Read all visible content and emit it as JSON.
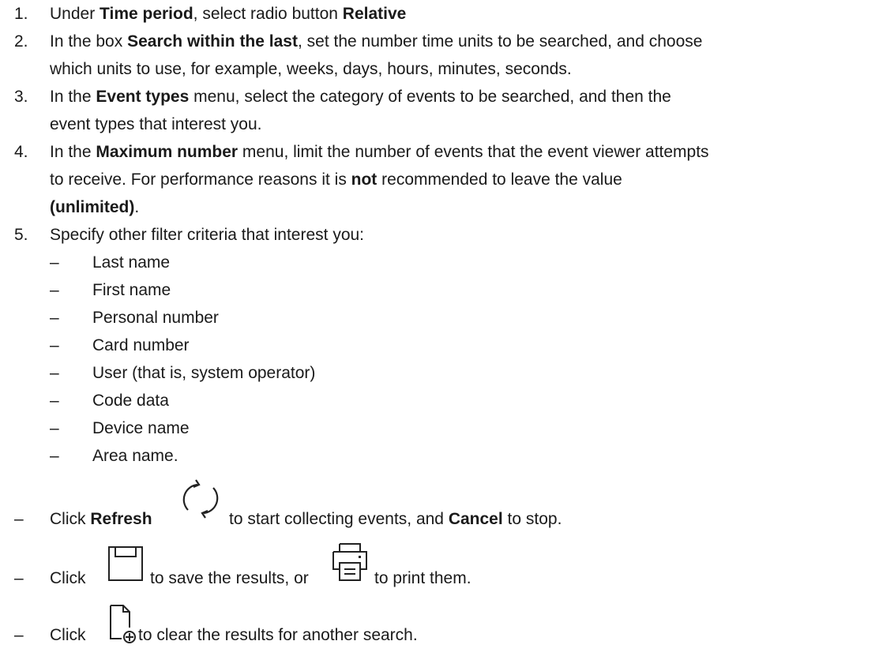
{
  "steps": [
    {
      "num": "1.",
      "parts": [
        {
          "t": "Under "
        },
        {
          "t": "Time period",
          "b": true
        },
        {
          "t": ", select radio button "
        },
        {
          "t": "Relative",
          "b": true
        }
      ]
    },
    {
      "num": "2.",
      "parts": [
        {
          "t": "In the box "
        },
        {
          "t": "Search within the last",
          "b": true
        },
        {
          "t": ", set the number time units to be searched, and choose"
        }
      ],
      "line2": "which units to use, for example, weeks, days, hours, minutes, seconds."
    },
    {
      "num": "3.",
      "parts": [
        {
          "t": "In the "
        },
        {
          "t": "Event types",
          "b": true
        },
        {
          "t": " menu, select the category of events to be searched, and then the"
        }
      ],
      "line2": "event types that interest you."
    },
    {
      "num": "4.",
      "parts": [
        {
          "t": "In the "
        },
        {
          "t": "Maximum number",
          "b": true
        },
        {
          "t": " menu, limit the number of events that the event viewer attempts"
        }
      ],
      "line2_parts": [
        {
          "t": "to receive. For performance reasons it is "
        },
        {
          "t": "not",
          "b": true
        },
        {
          "t": " recommended to leave the value"
        }
      ],
      "line3_parts": [
        {
          "t": "(unlimited)",
          "b": true
        },
        {
          "t": "."
        }
      ]
    },
    {
      "num": "5.",
      "parts": [
        {
          "t": "Specify other filter criteria that interest you:"
        }
      ]
    }
  ],
  "dash": "–",
  "criteria": [
    "Last name",
    "First name",
    "Personal number",
    "Card number",
    "User (that is, system operator)",
    "Code data",
    "Device name",
    "Area name."
  ],
  "bullets": {
    "refresh": {
      "pre": "Click ",
      "bold1": "Refresh",
      "mid": " to start collecting events, and ",
      "bold2": "Cancel",
      "post": " to stop."
    },
    "save": {
      "pre": "Click ",
      "mid": " to save the results, or ",
      "post": " to print them."
    },
    "clear": {
      "pre": "Click ",
      "post": " to clear the results for another search."
    }
  },
  "icons": [
    "refresh-icon",
    "save-icon",
    "print-icon",
    "clear-results-icon"
  ]
}
